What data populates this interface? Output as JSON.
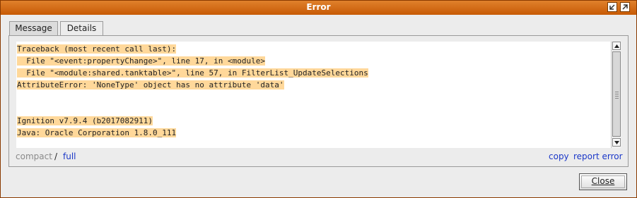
{
  "window": {
    "title": "Error",
    "colors": {
      "titlebar": "#d06810",
      "highlight": "#ffd89a",
      "link": "#1a37c8"
    }
  },
  "titlebar_buttons": [
    {
      "icon": "minimize-arrow-icon"
    },
    {
      "icon": "maximize-arrow-icon"
    }
  ],
  "tabs": [
    {
      "label": "Message",
      "active": false
    },
    {
      "label": "Details",
      "active": true
    }
  ],
  "details": {
    "lines": [
      "Traceback (most recent call last):",
      "  File \"<event:propertyChange>\", line 17, in <module>",
      "  File \"<module:shared.tanktable>\", line 57, in FilterList_UpdateSelections",
      "AttributeError: 'NoneType' object has no attribute 'data'",
      "",
      "",
      "Ignition v7.9.4 (b2017082911)",
      "Java: Oracle Corporation 1.8.0_111"
    ]
  },
  "view_links": {
    "compact": "compact",
    "separator": "/",
    "full": "full"
  },
  "actions": {
    "copy": "copy",
    "report_error": "report error"
  },
  "buttons": {
    "close": "Close"
  }
}
